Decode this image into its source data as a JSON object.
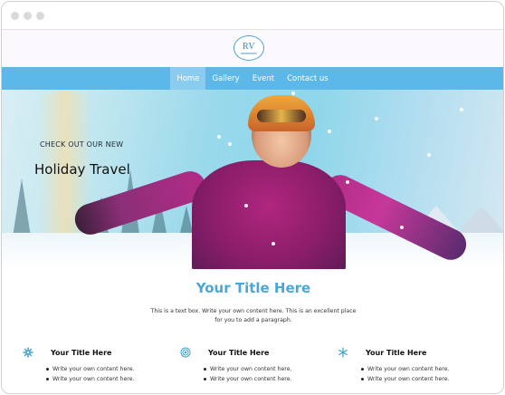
{
  "logo": {
    "text": "RV"
  },
  "nav": {
    "items": [
      {
        "label": "Home",
        "active": true
      },
      {
        "label": "Gallery",
        "active": false
      },
      {
        "label": "Event",
        "active": false
      },
      {
        "label": "Contact us",
        "active": false
      }
    ]
  },
  "hero": {
    "kicker": "CHECK OUT OUR NEW",
    "title": "Holiday Travel"
  },
  "main": {
    "title": "Your Title Here",
    "text": "This is a text box. Write your own content here. This is an excellent place for you to add a paragraph."
  },
  "columns": [
    {
      "icon": "gear-icon",
      "title": "Your Title Here",
      "items": [
        "Write your own content here.",
        "Write your own content here."
      ]
    },
    {
      "icon": "target-icon",
      "title": "Your Title Here",
      "items": [
        "Write your own content here.",
        "Write your own content here."
      ]
    },
    {
      "icon": "snowflake-icon",
      "title": "Your Title Here",
      "items": [
        "Write your own content here.",
        "Write your own content here."
      ]
    }
  ],
  "colors": {
    "accent": "#4aa8d8",
    "nav": "#5db8ea"
  }
}
